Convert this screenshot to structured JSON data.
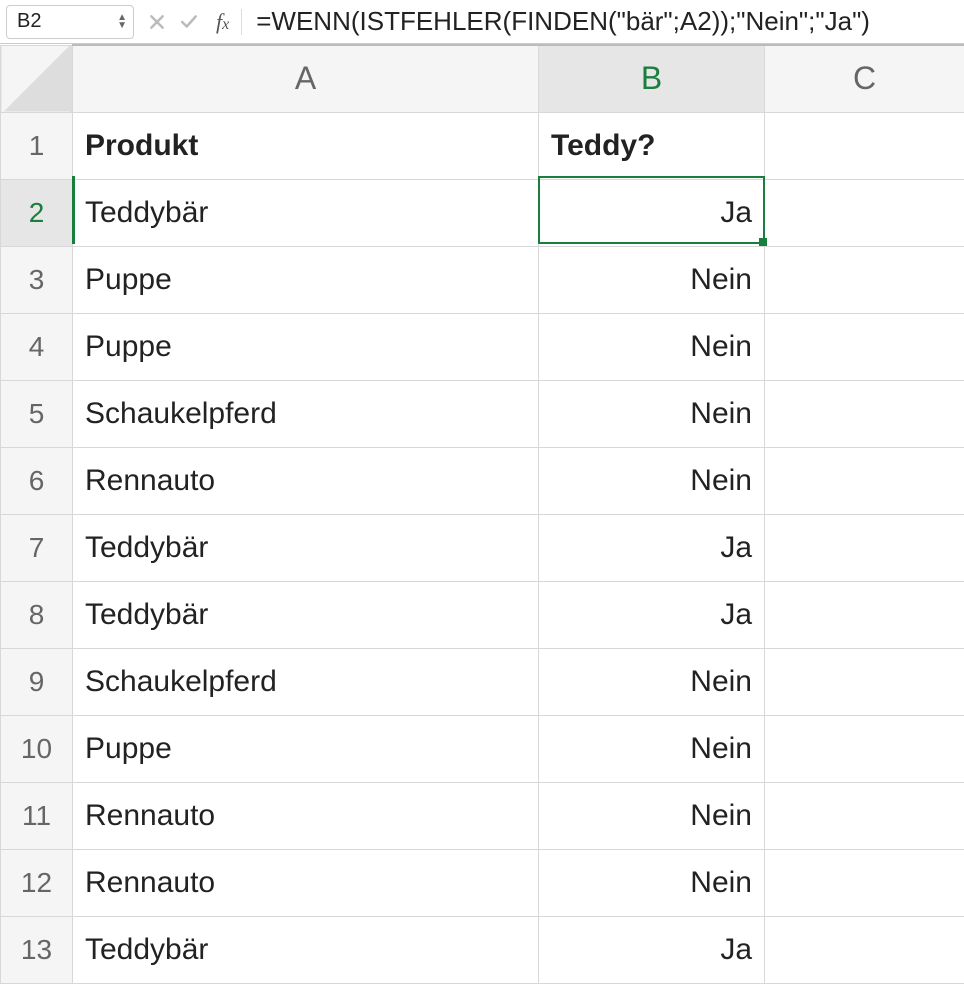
{
  "formulaBar": {
    "nameBox": "B2",
    "formula": "=WENN(ISTFEHLER(FINDEN(\"bär\";A2));\"Nein\";\"Ja\")"
  },
  "columns": [
    "A",
    "B",
    "C"
  ],
  "activeColumn": "B",
  "activeRow": "2",
  "headers": {
    "A": "Produkt",
    "B": "Teddy?"
  },
  "rows": [
    {
      "n": "1",
      "A": "Produkt",
      "B": "Teddy?",
      "bold": true,
      "bRight": false
    },
    {
      "n": "2",
      "A": "Teddybär",
      "B": "Ja",
      "bold": false,
      "bRight": true
    },
    {
      "n": "3",
      "A": "Puppe",
      "B": "Nein",
      "bold": false,
      "bRight": true
    },
    {
      "n": "4",
      "A": "Puppe",
      "B": "Nein",
      "bold": false,
      "bRight": true
    },
    {
      "n": "5",
      "A": "Schaukelpferd",
      "B": "Nein",
      "bold": false,
      "bRight": true
    },
    {
      "n": "6",
      "A": "Rennauto",
      "B": "Nein",
      "bold": false,
      "bRight": true
    },
    {
      "n": "7",
      "A": "Teddybär",
      "B": "Ja",
      "bold": false,
      "bRight": true
    },
    {
      "n": "8",
      "A": "Teddybär",
      "B": "Ja",
      "bold": false,
      "bRight": true
    },
    {
      "n": "9",
      "A": "Schaukelpferd",
      "B": "Nein",
      "bold": false,
      "bRight": true
    },
    {
      "n": "10",
      "A": "Puppe",
      "B": "Nein",
      "bold": false,
      "bRight": true
    },
    {
      "n": "11",
      "A": "Rennauto",
      "B": "Nein",
      "bold": false,
      "bRight": true
    },
    {
      "n": "12",
      "A": "Rennauto",
      "B": "Nein",
      "bold": false,
      "bRight": true
    },
    {
      "n": "13",
      "A": "Teddybär",
      "B": "Ja",
      "bold": false,
      "bRight": true
    }
  ]
}
